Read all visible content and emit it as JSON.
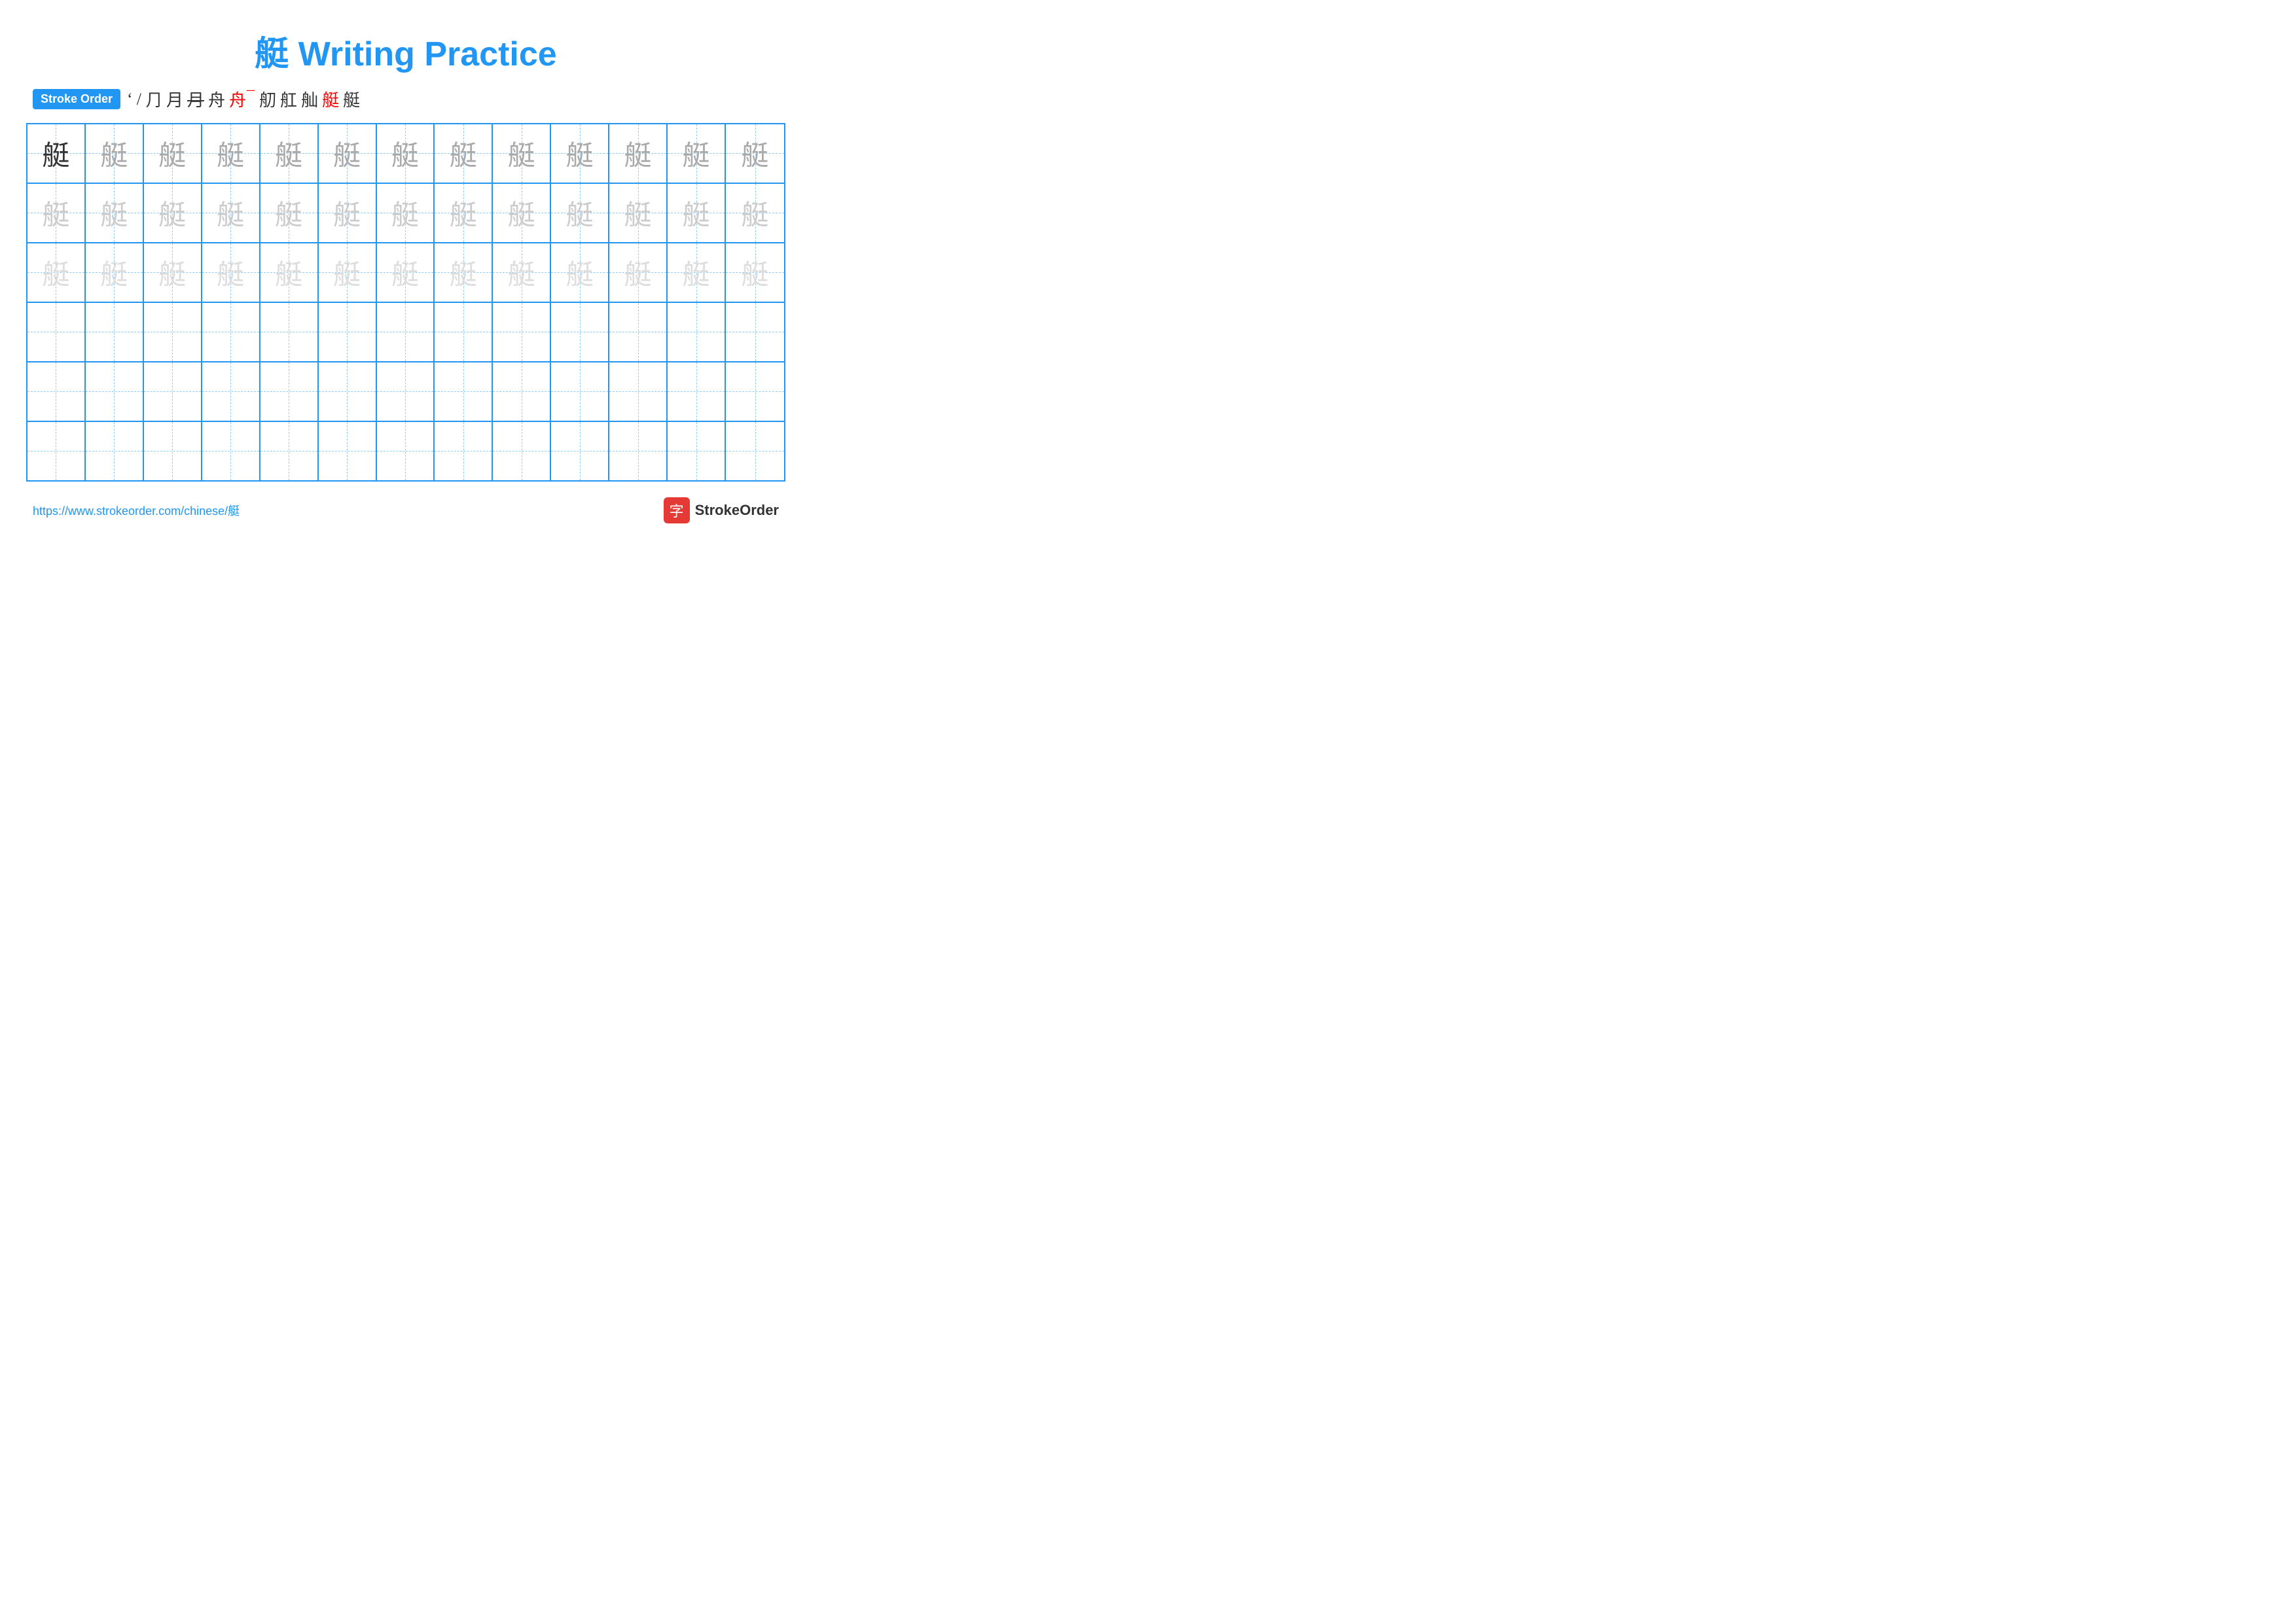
{
  "title": "艇 Writing Practice",
  "stroke_order_label": "Stroke Order",
  "stroke_steps": [
    "'",
    "⌐",
    "⌐",
    "⌐",
    "⌐",
    "⌐",
    "⌐",
    "⌐",
    "⌐",
    "⌐",
    "⌐",
    "⌐"
  ],
  "character": "艇",
  "rows": [
    {
      "type": "practice",
      "shades": [
        "dark",
        "medium",
        "medium",
        "medium",
        "medium",
        "medium",
        "medium",
        "medium",
        "medium",
        "medium",
        "medium",
        "medium",
        "medium"
      ]
    },
    {
      "type": "practice",
      "shades": [
        "light",
        "light",
        "light",
        "light",
        "light",
        "light",
        "light",
        "light",
        "light",
        "light",
        "light",
        "light",
        "light"
      ]
    },
    {
      "type": "practice",
      "shades": [
        "very-light",
        "very-light",
        "very-light",
        "very-light",
        "very-light",
        "very-light",
        "very-light",
        "very-light",
        "very-light",
        "very-light",
        "very-light",
        "very-light",
        "very-light"
      ]
    },
    {
      "type": "empty"
    },
    {
      "type": "empty"
    },
    {
      "type": "empty"
    }
  ],
  "footer": {
    "url": "https://www.strokeorder.com/chinese/艇",
    "logo_char": "字",
    "logo_text": "StrokeOrder"
  }
}
